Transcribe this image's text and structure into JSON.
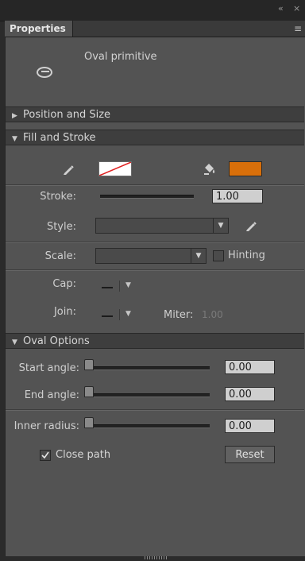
{
  "window": {
    "collapse_glyph": "«",
    "close_glyph": "×"
  },
  "tab": {
    "title": "Properties",
    "menu_glyph": "≡"
  },
  "object": {
    "name": "Oval primitive",
    "icon": "oval-primitive-icon"
  },
  "sections": {
    "position_size": "Position and Size",
    "fill_stroke": "Fill and Stroke",
    "oval_options": "Oval Options"
  },
  "fill_stroke": {
    "stroke_color_icon": "pencil-icon",
    "fill_color_icon": "paint-bucket-icon",
    "fill_color": "#d86f0a",
    "stroke_label": "Stroke:",
    "stroke_value": "1.00",
    "style_label": "Style:",
    "style_value": "",
    "scale_label": "Scale:",
    "scale_value": "",
    "hinting_label": "Hinting",
    "hinting_checked": false,
    "cap_label": "Cap:",
    "join_label": "Join:",
    "miter_label": "Miter:",
    "miter_value": "1.00"
  },
  "oval_options": {
    "start_angle_label": "Start angle:",
    "start_angle_value": "0.00",
    "end_angle_label": "End angle:",
    "end_angle_value": "0.00",
    "inner_radius_label": "Inner radius:",
    "inner_radius_value": "0.00",
    "close_path_label": "Close path",
    "close_path_checked": true,
    "reset_label": "Reset"
  }
}
